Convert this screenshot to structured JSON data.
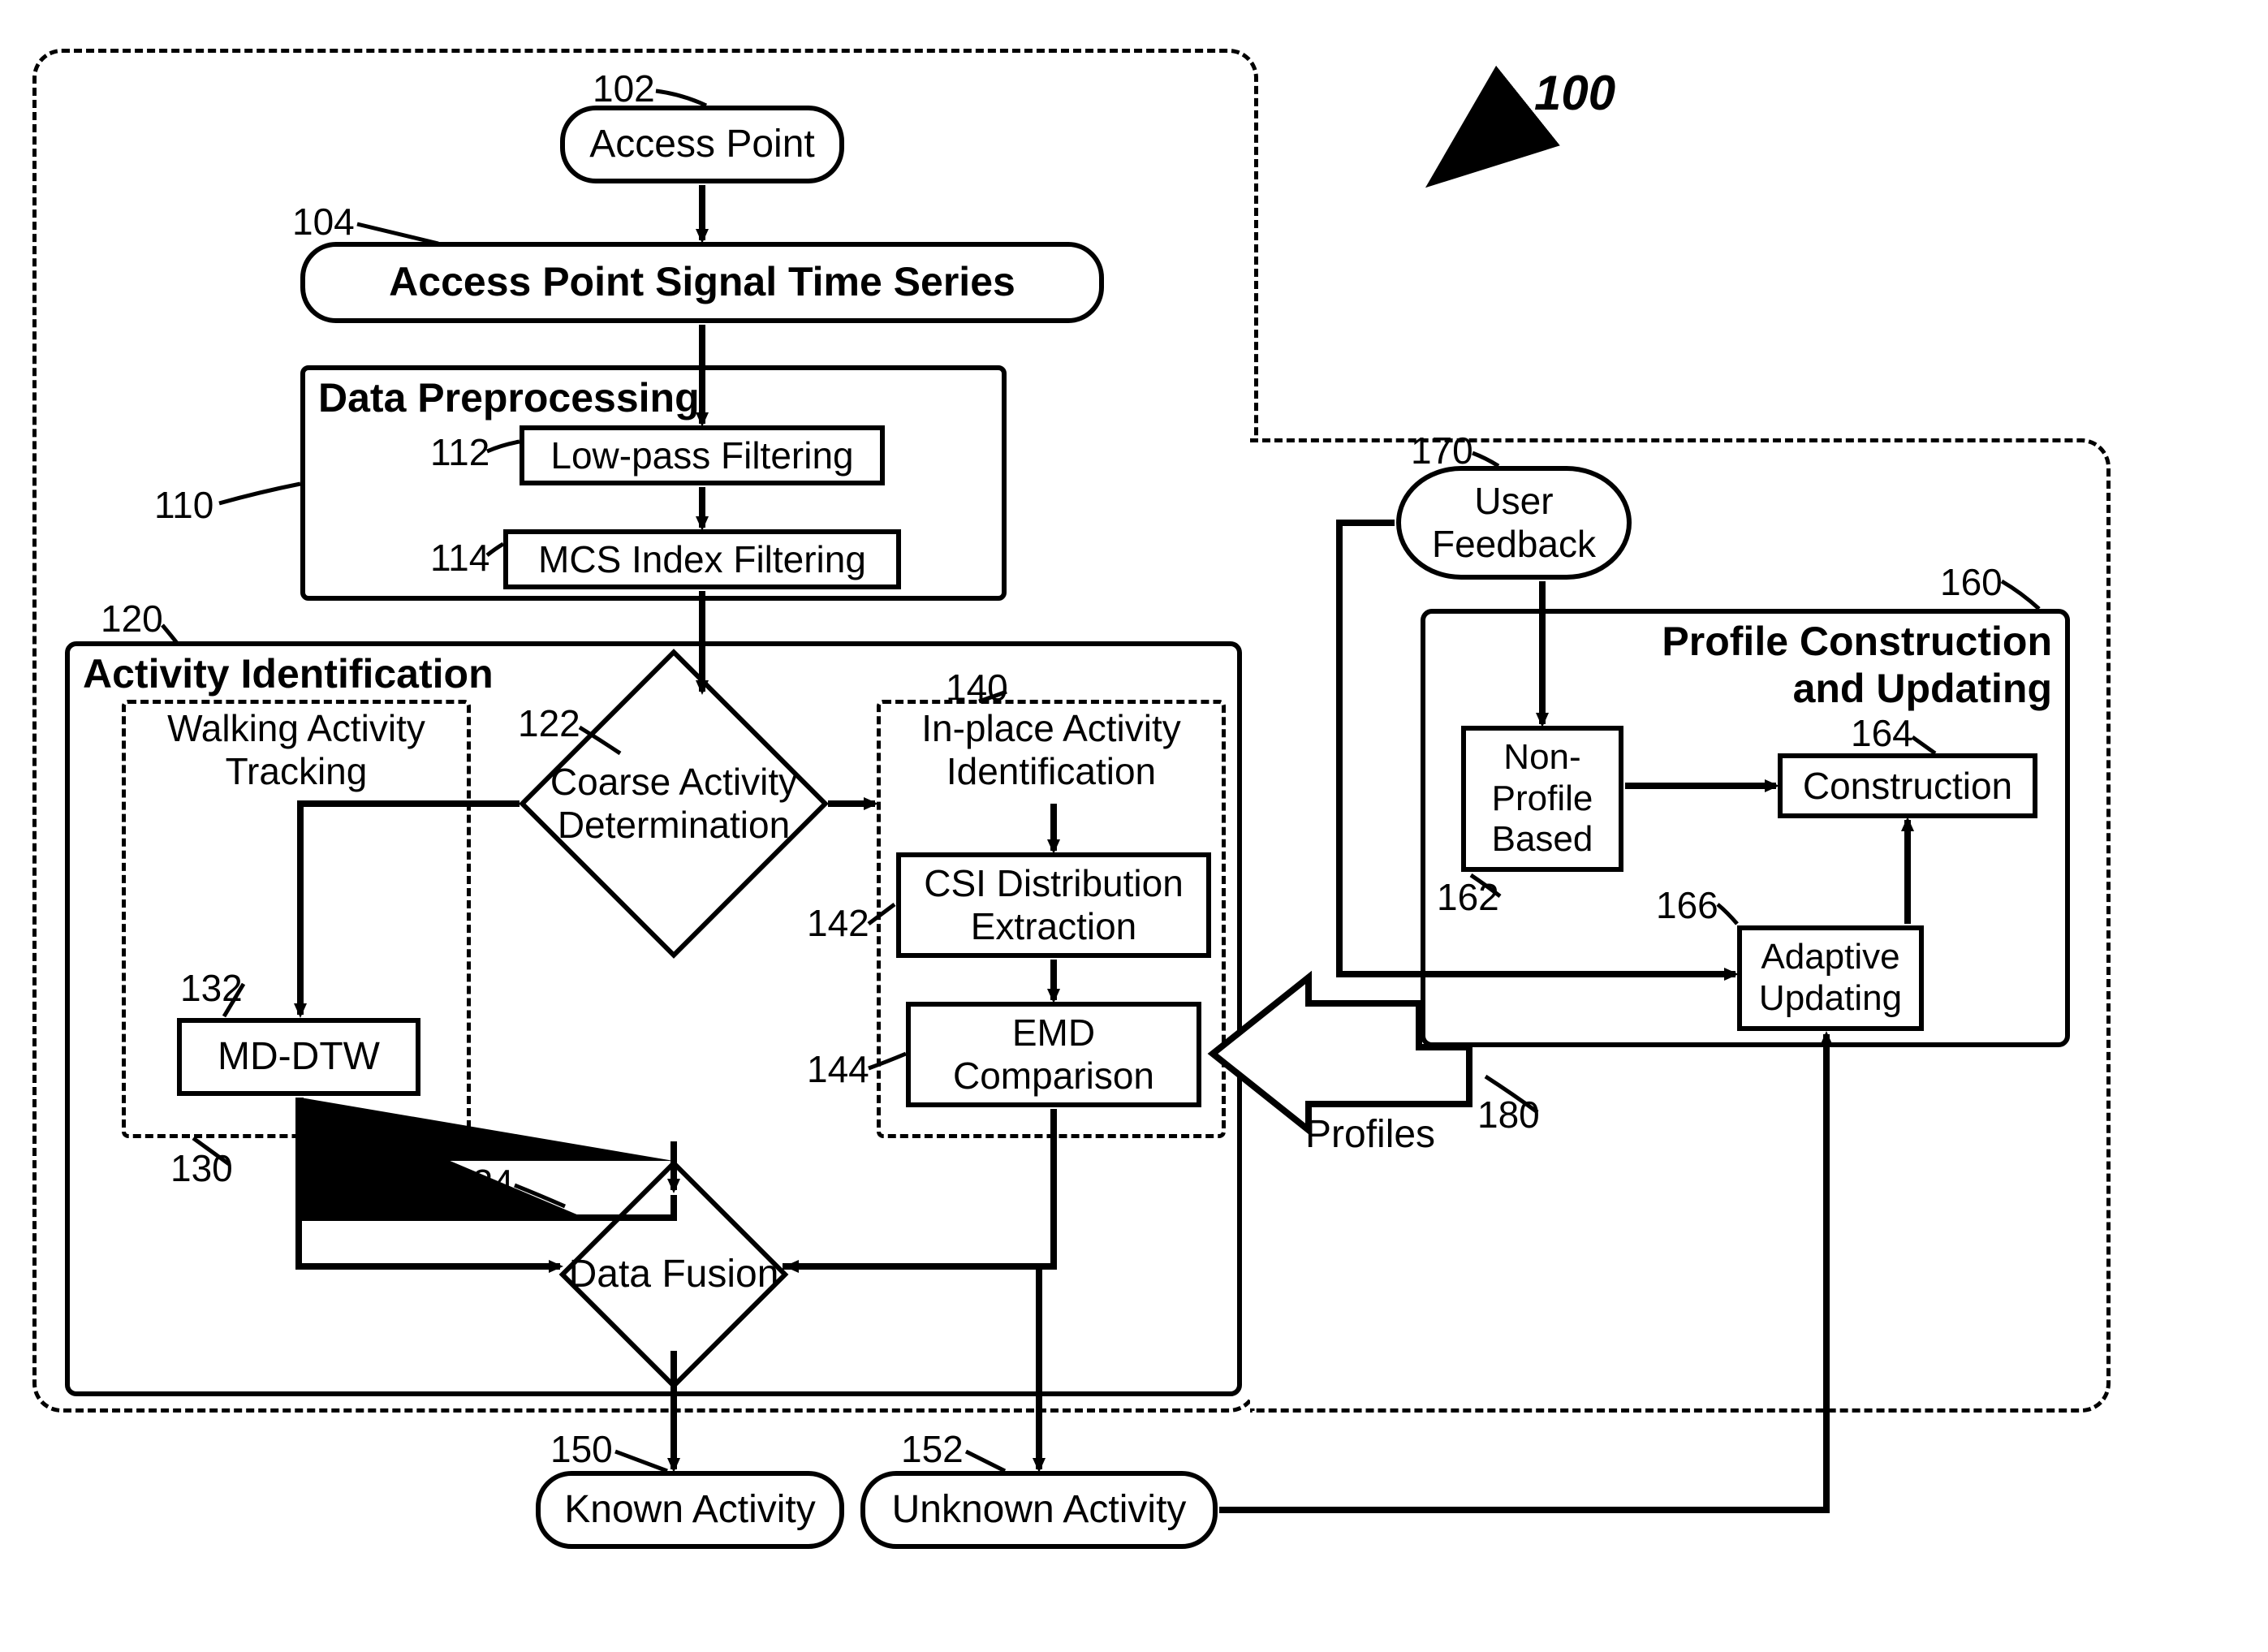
{
  "fig_id_label_text": "100",
  "refs": {
    "access_point": "102",
    "signal_series": "104",
    "preproc": "110",
    "lowpass": "112",
    "mcs": "114",
    "activity_id": "120",
    "coarse": "122",
    "data_fusion": "124",
    "walking": "130",
    "mddtw": "132",
    "inplace": "140",
    "csi": "142",
    "emd": "144",
    "known": "150",
    "unknown": "152",
    "profile": "160",
    "nonprofile": "162",
    "construction": "164",
    "adaptive": "166",
    "feedback": "170",
    "profiles": "180"
  },
  "texts": {
    "access_point": "Access Point",
    "signal_series": "Access Point Signal Time Series",
    "preproc_title": "Data Preprocessing",
    "lowpass": "Low-pass Filtering",
    "mcs": "MCS Index Filtering",
    "activity_id_title": "Activity Identification",
    "walking_title": "Walking Activity\nTracking",
    "coarse": "Coarse Activity\nDetermination",
    "inplace_title": "In-place Activity\nIdentification",
    "csi": "CSI Distribution\nExtraction",
    "emd": "EMD\nComparison",
    "mddtw": "MD-DTW",
    "data_fusion": "Data Fusion",
    "known": "Known Activity",
    "unknown": "Unknown Activity",
    "profile_title": "Profile Construction\nand Updating",
    "nonprofile": "Non-\nProfile\nBased",
    "construction": "Construction",
    "adaptive": "Adaptive\nUpdating",
    "feedback": "User\nFeedback",
    "profiles": "Profiles"
  },
  "chart_data": {
    "type": "flowchart",
    "nodes": [
      {
        "id": "102",
        "label": "Access Point",
        "shape": "terminator"
      },
      {
        "id": "104",
        "label": "Access Point Signal Time Series",
        "shape": "terminator"
      },
      {
        "id": "110",
        "label": "Data Preprocessing",
        "shape": "container",
        "children": [
          "112",
          "114"
        ]
      },
      {
        "id": "112",
        "label": "Low-pass Filtering",
        "shape": "process"
      },
      {
        "id": "114",
        "label": "MCS Index Filtering",
        "shape": "process"
      },
      {
        "id": "120",
        "label": "Activity Identification",
        "shape": "container",
        "children": [
          "122",
          "124",
          "130",
          "140"
        ]
      },
      {
        "id": "122",
        "label": "Coarse Activity Determination",
        "shape": "decision"
      },
      {
        "id": "124",
        "label": "Data Fusion",
        "shape": "decision"
      },
      {
        "id": "130",
        "label": "Walking Activity Tracking",
        "shape": "container-dashed",
        "children": [
          "132"
        ]
      },
      {
        "id": "132",
        "label": "MD-DTW",
        "shape": "process"
      },
      {
        "id": "140",
        "label": "In-place Activity Identification",
        "shape": "container-dashed",
        "children": [
          "142",
          "144"
        ]
      },
      {
        "id": "142",
        "label": "CSI Distribution Extraction",
        "shape": "process"
      },
      {
        "id": "144",
        "label": "EMD Comparison",
        "shape": "process"
      },
      {
        "id": "150",
        "label": "Known Activity",
        "shape": "terminator"
      },
      {
        "id": "152",
        "label": "Unknown Activity",
        "shape": "terminator"
      },
      {
        "id": "160",
        "label": "Profile Construction and Updating",
        "shape": "container",
        "children": [
          "162",
          "164",
          "166"
        ]
      },
      {
        "id": "162",
        "label": "Non-Profile Based",
        "shape": "process"
      },
      {
        "id": "164",
        "label": "Construction",
        "shape": "process"
      },
      {
        "id": "166",
        "label": "Adaptive Updating",
        "shape": "process"
      },
      {
        "id": "170",
        "label": "User Feedback",
        "shape": "terminator"
      },
      {
        "id": "180",
        "label": "Profiles",
        "shape": "block-arrow"
      }
    ],
    "edges": [
      {
        "from": "102",
        "to": "104"
      },
      {
        "from": "104",
        "to": "112"
      },
      {
        "from": "112",
        "to": "114"
      },
      {
        "from": "114",
        "to": "122"
      },
      {
        "from": "122",
        "to": "130"
      },
      {
        "from": "130",
        "to": "132"
      },
      {
        "from": "122",
        "to": "140"
      },
      {
        "from": "140",
        "to": "142"
      },
      {
        "from": "142",
        "to": "144"
      },
      {
        "from": "132",
        "to": "124"
      },
      {
        "from": "144",
        "to": "124"
      },
      {
        "from": "124",
        "to": "150"
      },
      {
        "from": "124",
        "to": "152"
      },
      {
        "from": "152",
        "to": "166"
      },
      {
        "from": "170",
        "to": "162"
      },
      {
        "from": "170",
        "to": "166"
      },
      {
        "from": "162",
        "to": "164"
      },
      {
        "from": "166",
        "to": "164"
      },
      {
        "from": "160",
        "to": "144",
        "via": "180"
      }
    ]
  }
}
